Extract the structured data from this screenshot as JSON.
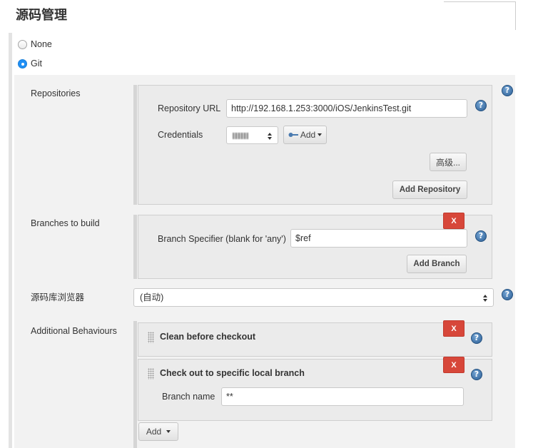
{
  "section": {
    "title": "源码管理"
  },
  "scm_options": [
    {
      "label": "None",
      "selected": false
    },
    {
      "label": "Git",
      "selected": true
    }
  ],
  "repositories": {
    "label": "Repositories",
    "url_label": "Repository URL",
    "url_value": "http://192.168.1.253:3000/iOS/JenkinsTest.git",
    "credentials_label": "Credentials",
    "credentials_add_label": "Add",
    "advanced_label": "高级...",
    "add_repository_label": "Add Repository"
  },
  "branches": {
    "label": "Branches to build",
    "delete_label": "X",
    "specifier_label": "Branch Specifier (blank for 'any')",
    "specifier_value": "$ref",
    "add_branch_label": "Add Branch"
  },
  "repository_browser": {
    "label": "源码库浏览器",
    "value": "(自动)"
  },
  "additional_behaviours": {
    "label": "Additional Behaviours",
    "items": [
      {
        "title": "Clean before checkout",
        "delete_label": "X"
      },
      {
        "title": "Check out to specific local branch",
        "delete_label": "X",
        "field_label": "Branch name",
        "field_value": "**"
      }
    ],
    "add_label": "Add"
  },
  "icons": {
    "help": "help-icon",
    "help_glyph": "?",
    "key": "key-icon",
    "drag": "drag-handle-icon",
    "dropdown": "chevron-down-icon",
    "select": "select-arrows-icon"
  },
  "colors": {
    "accent": "#1f8ff5",
    "danger": "#d7473a",
    "help": "#3a6ea5",
    "panel": "#f2f2f2"
  }
}
